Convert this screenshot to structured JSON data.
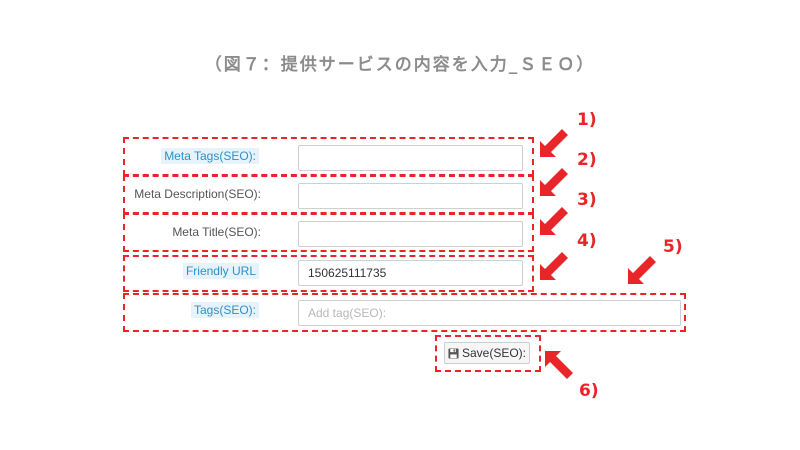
{
  "caption": "（図７：提供サービスの内容を入力_ＳＥＯ）",
  "form": {
    "meta_tags": {
      "label": "Meta Tags(SEO):",
      "value": ""
    },
    "meta_description": {
      "label": "Meta Description(SEO):",
      "value": ""
    },
    "meta_title": {
      "label": "Meta Title(SEO):",
      "value": ""
    },
    "friendly_url": {
      "label": "Friendly URL",
      "value": "150625111735"
    },
    "tags": {
      "label": "Tags(SEO):",
      "placeholder": "Add tag(SEO):"
    },
    "save_label": "Save(SEO):",
    "save_icon": "floppy-disk-icon"
  },
  "annotations": {
    "color": "#e8262a",
    "numbers": [
      "1)",
      "2)",
      "3)",
      "4)",
      "5)",
      "6)"
    ]
  }
}
